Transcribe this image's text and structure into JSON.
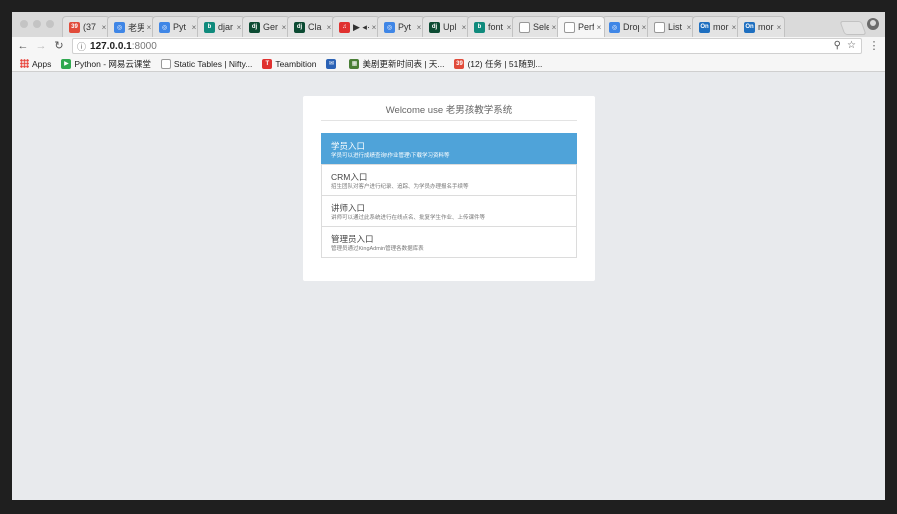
{
  "tabs": [
    {
      "title": "(37",
      "icon": "red-badge-icon",
      "color": "#e14b3a",
      "glyph": "39"
    },
    {
      "title": "老男",
      "icon": "blue-circle-icon",
      "color": "#3f86e6",
      "glyph": "◎"
    },
    {
      "title": "Pyt",
      "icon": "blue-circle-icon",
      "color": "#3f86e6",
      "glyph": "◎"
    },
    {
      "title": "djar",
      "icon": "bing-icon",
      "color": "#0f8a7c",
      "glyph": "b"
    },
    {
      "title": "Ger",
      "icon": "django-icon",
      "color": "#0c4b33",
      "glyph": "dj"
    },
    {
      "title": "Cla",
      "icon": "django-icon",
      "color": "#0c4b33",
      "glyph": "dj"
    },
    {
      "title": "▶ ◂·",
      "icon": "netease-icon",
      "color": "#e0312f",
      "glyph": "♫"
    },
    {
      "title": "Pyt",
      "icon": "blue-circle-icon",
      "color": "#3f86e6",
      "glyph": "◎"
    },
    {
      "title": "Upl",
      "icon": "django-icon",
      "color": "#0c4b33",
      "glyph": "dj"
    },
    {
      "title": "font",
      "icon": "bing-icon",
      "color": "#0f8a7c",
      "glyph": "b"
    },
    {
      "title": "Sele",
      "icon": "page-icon",
      "color": "#ffffff",
      "glyph": ""
    },
    {
      "title": "Perf",
      "icon": "page-icon",
      "color": "#ffffff",
      "glyph": ""
    },
    {
      "title": "Drop",
      "icon": "blue-circle-icon",
      "color": "#3f86e6",
      "glyph": "◎"
    },
    {
      "title": "List",
      "icon": "page-icon",
      "color": "#ffffff",
      "glyph": ""
    },
    {
      "title": "mor",
      "icon": "on-icon",
      "color": "#1e6fc0",
      "glyph": "On"
    },
    {
      "title": "mor",
      "icon": "on-icon",
      "color": "#1e6fc0",
      "glyph": "On"
    }
  ],
  "active_tab": 11,
  "address": {
    "host": "127.0.0.1",
    "port": ":8000"
  },
  "bookmarks": [
    {
      "label": "Apps",
      "icon": "apps-grid-icon",
      "color": "#e8453c",
      "glyph": ""
    },
    {
      "label": "Python - 网易云课堂",
      "icon": "netease-study-icon",
      "color": "#2fa84f",
      "glyph": "▶"
    },
    {
      "label": "Static Tables | Nifty...",
      "icon": "page-icon",
      "color": "#ffffff",
      "glyph": ""
    },
    {
      "label": "Teambition",
      "icon": "teambition-icon",
      "color": "#e0312f",
      "glyph": "T"
    },
    {
      "label": "",
      "icon": "email-icon",
      "color": "#2b62b5",
      "glyph": "✉"
    },
    {
      "label": "美剧更新时间表 | 天...",
      "icon": "tv-icon",
      "color": "#4a7f36",
      "glyph": "▦"
    },
    {
      "label": "(12) 任务 | 51随到...",
      "icon": "red-badge-icon",
      "color": "#e14b3a",
      "glyph": "39"
    }
  ],
  "panel": {
    "title": "Welcome use 老男孩教学系统",
    "entries": [
      {
        "title": "学员入口",
        "desc": "学员可以进行成绩查询\\作业管理\\下载学习资料等",
        "active": true
      },
      {
        "title": "CRM入口",
        "desc": "招生团队对客户进行纪录、追踪、为学员办理报名手续等",
        "active": false
      },
      {
        "title": "讲师入口",
        "desc": "讲师可以通过此系统进行在线点名、批复学生作业、上传课件等",
        "active": false
      },
      {
        "title": "管理员入口",
        "desc": "管理员通过KingAdmin管理各数据库表",
        "active": false
      }
    ]
  },
  "colors": {
    "accent": "#4fa3d9",
    "background": "#e8eaed"
  }
}
